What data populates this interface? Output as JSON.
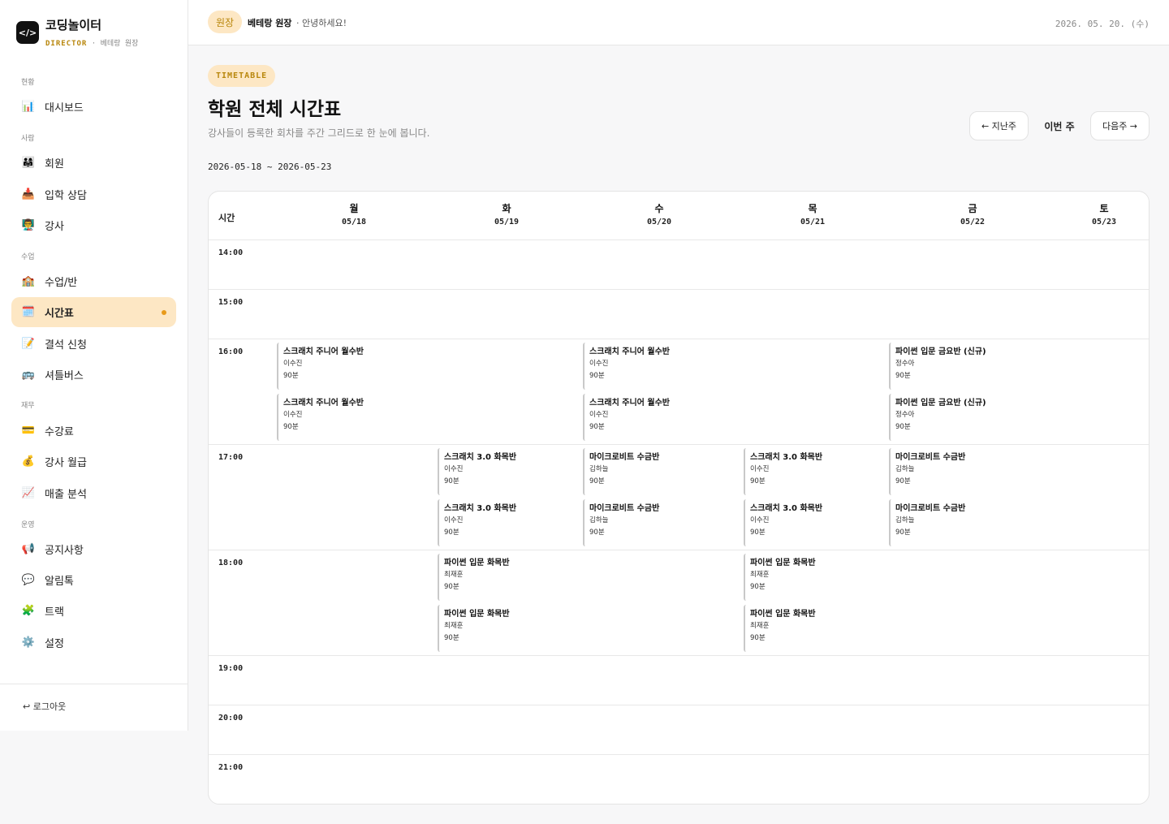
{
  "brand": {
    "logo": "</>",
    "name": "코딩놀이터",
    "role": "DIRECTOR",
    "sub": "· 베테랑 원장"
  },
  "nav": [
    {
      "section": "현황"
    },
    {
      "label": "대시보드",
      "icon": "📊",
      "name": "dashboard"
    },
    {
      "section": "사람"
    },
    {
      "label": "회원",
      "icon": "👨‍👩‍👧",
      "name": "members"
    },
    {
      "label": "입학 상담",
      "icon": "📥",
      "name": "admission-consult"
    },
    {
      "label": "강사",
      "icon": "👨‍🏫",
      "name": "instructors"
    },
    {
      "section": "수업"
    },
    {
      "label": "수업/반",
      "icon": "🏫",
      "name": "classes"
    },
    {
      "label": "시간표",
      "icon": "🗓️",
      "name": "timetable",
      "active": true
    },
    {
      "label": "결석 신청",
      "icon": "📝",
      "name": "absence"
    },
    {
      "label": "셔틀버스",
      "icon": "🚌",
      "name": "shuttle"
    },
    {
      "section": "재무"
    },
    {
      "label": "수강료",
      "icon": "💳",
      "name": "tuition"
    },
    {
      "label": "강사 월급",
      "icon": "💰",
      "name": "salary"
    },
    {
      "label": "매출 분석",
      "icon": "📈",
      "name": "sales"
    },
    {
      "section": "운영"
    },
    {
      "label": "공지사항",
      "icon": "📢",
      "name": "notices"
    },
    {
      "label": "알림톡",
      "icon": "💬",
      "name": "alimtalk"
    },
    {
      "label": "트랙",
      "icon": "🧩",
      "name": "tracks"
    },
    {
      "label": "설정",
      "icon": "⚙️",
      "name": "settings"
    }
  ],
  "logout": "↩ 로그아웃",
  "topbar": {
    "role": "원장",
    "name": "베테랑 원장",
    "greeting": "· 안녕하세요!",
    "date": "2026. 05. 20. (수)"
  },
  "page": {
    "tag": "TIMETABLE",
    "title": "학원 전체 시간표",
    "subtitle": "강사들이 등록한 회차를 주간 그리드로 한 눈에 봅니다.",
    "range": "2026-05-18 ~ 2026-05-23",
    "prev": "← 지난주",
    "current": "이번 주",
    "next": "다음주 →"
  },
  "calendar": {
    "time_header": "시간",
    "days": [
      {
        "name": "월",
        "date": "05/18"
      },
      {
        "name": "화",
        "date": "05/19"
      },
      {
        "name": "수",
        "date": "05/20"
      },
      {
        "name": "목",
        "date": "05/21"
      },
      {
        "name": "금",
        "date": "05/22"
      },
      {
        "name": "토",
        "date": "05/23"
      }
    ],
    "hours": [
      "14:00",
      "15:00",
      "16:00",
      "17:00",
      "18:00",
      "19:00",
      "20:00",
      "21:00"
    ],
    "events": [
      {
        "day": 0,
        "hour": "16:00",
        "slot": 0,
        "title": "스크래치 주니어 월수반",
        "teacher": "이수진",
        "duration": "90분"
      },
      {
        "day": 0,
        "hour": "16:00",
        "slot": 1,
        "title": "스크래치 주니어 월수반",
        "teacher": "이수진",
        "duration": "90분"
      },
      {
        "day": 2,
        "hour": "16:00",
        "slot": 0,
        "title": "스크래치 주니어 월수반",
        "teacher": "이수진",
        "duration": "90분"
      },
      {
        "day": 2,
        "hour": "16:00",
        "slot": 1,
        "title": "스크래치 주니어 월수반",
        "teacher": "이수진",
        "duration": "90분"
      },
      {
        "day": 4,
        "hour": "16:00",
        "slot": 0,
        "title": "파이썬 입문 금요반 (신규)",
        "teacher": "정수아",
        "duration": "90분"
      },
      {
        "day": 4,
        "hour": "16:00",
        "slot": 1,
        "title": "파이썬 입문 금요반 (신규)",
        "teacher": "정수아",
        "duration": "90분"
      },
      {
        "day": 1,
        "hour": "17:00",
        "slot": 0,
        "title": "스크래치 3.0 화목반",
        "teacher": "이수진",
        "duration": "90분"
      },
      {
        "day": 1,
        "hour": "17:00",
        "slot": 1,
        "title": "스크래치 3.0 화목반",
        "teacher": "이수진",
        "duration": "90분"
      },
      {
        "day": 2,
        "hour": "17:00",
        "slot": 0,
        "title": "마이크로비트 수금반",
        "teacher": "김하늘",
        "duration": "90분"
      },
      {
        "day": 2,
        "hour": "17:00",
        "slot": 1,
        "title": "마이크로비트 수금반",
        "teacher": "김하늘",
        "duration": "90분"
      },
      {
        "day": 3,
        "hour": "17:00",
        "slot": 0,
        "title": "스크래치 3.0 화목반",
        "teacher": "이수진",
        "duration": "90분"
      },
      {
        "day": 3,
        "hour": "17:00",
        "slot": 1,
        "title": "스크래치 3.0 화목반",
        "teacher": "이수진",
        "duration": "90분"
      },
      {
        "day": 4,
        "hour": "17:00",
        "slot": 0,
        "title": "마이크로비트 수금반",
        "teacher": "김하늘",
        "duration": "90분"
      },
      {
        "day": 4,
        "hour": "17:00",
        "slot": 1,
        "title": "마이크로비트 수금반",
        "teacher": "김하늘",
        "duration": "90분"
      },
      {
        "day": 1,
        "hour": "18:00",
        "slot": 0,
        "title": "파이썬 입문 화목반",
        "teacher": "최재훈",
        "duration": "90분"
      },
      {
        "day": 1,
        "hour": "18:00",
        "slot": 1,
        "title": "파이썬 입문 화목반",
        "teacher": "최재훈",
        "duration": "90분"
      },
      {
        "day": 3,
        "hour": "18:00",
        "slot": 0,
        "title": "파이썬 입문 화목반",
        "teacher": "최재훈",
        "duration": "90분"
      },
      {
        "day": 3,
        "hour": "18:00",
        "slot": 1,
        "title": "파이썬 입문 화목반",
        "teacher": "최재훈",
        "duration": "90분"
      }
    ]
  }
}
